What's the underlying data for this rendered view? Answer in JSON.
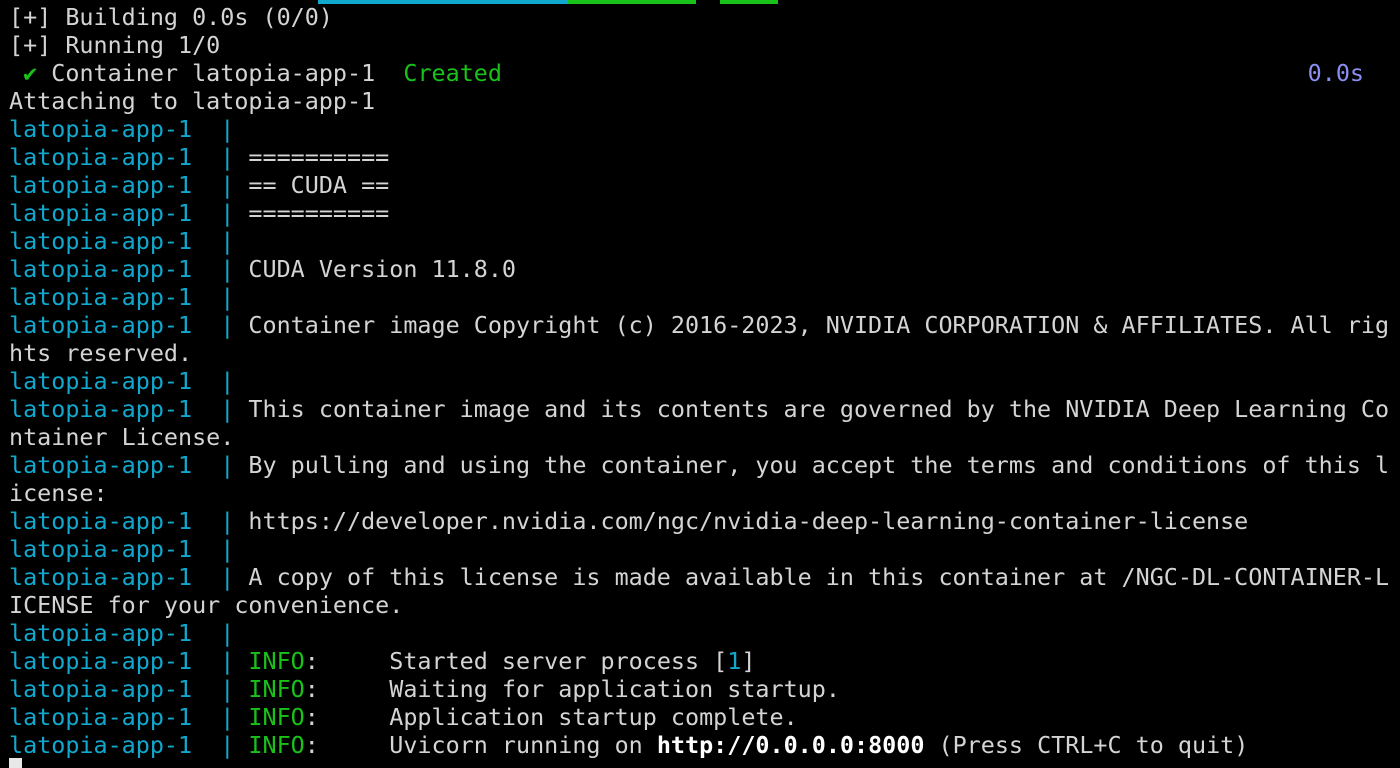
{
  "terminal": {
    "lines": [
      {
        "type": "plain",
        "text": "[+] Building 0.0s (0/0)"
      },
      {
        "type": "plain",
        "text": "[+] Running 1/0"
      },
      {
        "type": "container",
        "check": "✔",
        "text": "Container latopia-app-1",
        "status": "Created",
        "time": "0.0s"
      },
      {
        "type": "plain",
        "text": "Attaching to latopia-app-1"
      },
      {
        "type": "log",
        "prefix": "latopia-app-1  |",
        "text": ""
      },
      {
        "type": "log",
        "prefix": "latopia-app-1  |",
        "text": "=========="
      },
      {
        "type": "log",
        "prefix": "latopia-app-1  |",
        "text": "== CUDA =="
      },
      {
        "type": "log",
        "prefix": "latopia-app-1  |",
        "text": "=========="
      },
      {
        "type": "log",
        "prefix": "latopia-app-1  |",
        "text": ""
      },
      {
        "type": "log",
        "prefix": "latopia-app-1  |",
        "text": "CUDA Version 11.8.0"
      },
      {
        "type": "log",
        "prefix": "latopia-app-1  |",
        "text": ""
      },
      {
        "type": "log",
        "prefix": "latopia-app-1  |",
        "text": "Container image Copyright (c) 2016-2023, NVIDIA CORPORATION & AFFILIATES. All rig"
      },
      {
        "type": "plain",
        "text": "hts reserved."
      },
      {
        "type": "log",
        "prefix": "latopia-app-1  |",
        "text": ""
      },
      {
        "type": "log",
        "prefix": "latopia-app-1  |",
        "text": "This container image and its contents are governed by the NVIDIA Deep Learning Co"
      },
      {
        "type": "plain",
        "text": "ntainer License."
      },
      {
        "type": "log",
        "prefix": "latopia-app-1  |",
        "text": "By pulling and using the container, you accept the terms and conditions of this l"
      },
      {
        "type": "plain",
        "text": "icense:"
      },
      {
        "type": "log",
        "prefix": "latopia-app-1  |",
        "text": "https://developer.nvidia.com/ngc/nvidia-deep-learning-container-license"
      },
      {
        "type": "log",
        "prefix": "latopia-app-1  |",
        "text": ""
      },
      {
        "type": "log",
        "prefix": "latopia-app-1  |",
        "text": "A copy of this license is made available in this container at /NGC-DL-CONTAINER-L"
      },
      {
        "type": "plain",
        "text": "ICENSE for your convenience."
      },
      {
        "type": "log",
        "prefix": "latopia-app-1  |",
        "text": ""
      },
      {
        "type": "info",
        "prefix": "latopia-app-1  |",
        "level": "INFO",
        "gap": ":     ",
        "text": "Started server process [",
        "num": "1",
        "after": "]"
      },
      {
        "type": "info",
        "prefix": "latopia-app-1  |",
        "level": "INFO",
        "gap": ":     ",
        "text": "Waiting for application startup."
      },
      {
        "type": "info",
        "prefix": "latopia-app-1  |",
        "level": "INFO",
        "gap": ":     ",
        "text": "Application startup complete."
      },
      {
        "type": "info",
        "prefix": "latopia-app-1  |",
        "level": "INFO",
        "gap": ":     ",
        "text": "Uvicorn running on ",
        "bold": "http://0.0.0.0:8000",
        "after": " (Press CTRL+C to quit)"
      }
    ]
  },
  "colors": {
    "background": "#000000",
    "text": "#d4d4d4",
    "cyan": "#11a8cd",
    "green": "#19c219",
    "blue": "#8a8ff0"
  },
  "topbar_colors": [
    "#11a8cd",
    "#19c219",
    "#19c219"
  ]
}
